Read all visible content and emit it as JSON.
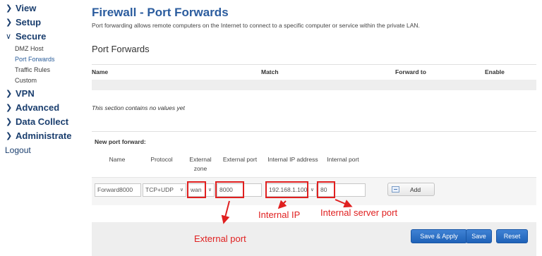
{
  "sidebar": {
    "top_items": [
      {
        "label": "View",
        "state": "collapsed"
      },
      {
        "label": "Setup",
        "state": "collapsed"
      },
      {
        "label": "Secure",
        "state": "expanded"
      },
      {
        "label": "VPN",
        "state": "collapsed"
      },
      {
        "label": "Advanced",
        "state": "collapsed"
      },
      {
        "label": "Data Collect",
        "state": "collapsed"
      },
      {
        "label": "Administrate",
        "state": "collapsed"
      }
    ],
    "secure_sub_items": [
      "DMZ Host",
      "Port Forwards",
      "Traffic Rules",
      "Custom"
    ],
    "active_sub_item": "Port Forwards",
    "logout_label": "Logout"
  },
  "page": {
    "title": "Firewall - Port Forwards",
    "description": "Port forwarding allows remote computers on the Internet to connect to a specific computer or service within the private LAN.",
    "section_title": "Port Forwards",
    "table_headers": [
      "Name",
      "Match",
      "Forward to",
      "Enable"
    ],
    "empty_message": "This section contains no values yet"
  },
  "new_forward": {
    "label": "New port forward:",
    "col_name": "Name",
    "col_protocol": "Protocol",
    "col_external_zone_1": "External",
    "col_external_zone_2": "zone",
    "col_external_port": "External port",
    "col_internal_ip": "Internal IP address",
    "col_internal_port": "Internal port",
    "name_value": "Forward8000",
    "protocol_value": "TCP+UDP",
    "zone_value": "wan",
    "external_port_value": "8000",
    "internal_ip_value": "192.168.1.100",
    "internal_port_value": "80",
    "add_label": "Add"
  },
  "footer": {
    "save_apply_label": "Save & Apply",
    "save_label": "Save",
    "reset_label": "Reset"
  },
  "annotations": {
    "external_port": "External port",
    "internal_ip": "Internal IP",
    "internal_server_port": "Internal server port"
  },
  "colors": {
    "title_blue": "#2b5c9e",
    "nav_blue": "#1a3e6e",
    "button_blue": "#2b6fc6",
    "annotation_red": "#e02020",
    "band_gray": "#eeeeee"
  },
  "icons": {
    "nav_collapsed": "chevron-right-icon",
    "nav_expanded": "chevron-down-icon",
    "select_arrow": "chevron-down-icon",
    "add": "add-icon"
  }
}
